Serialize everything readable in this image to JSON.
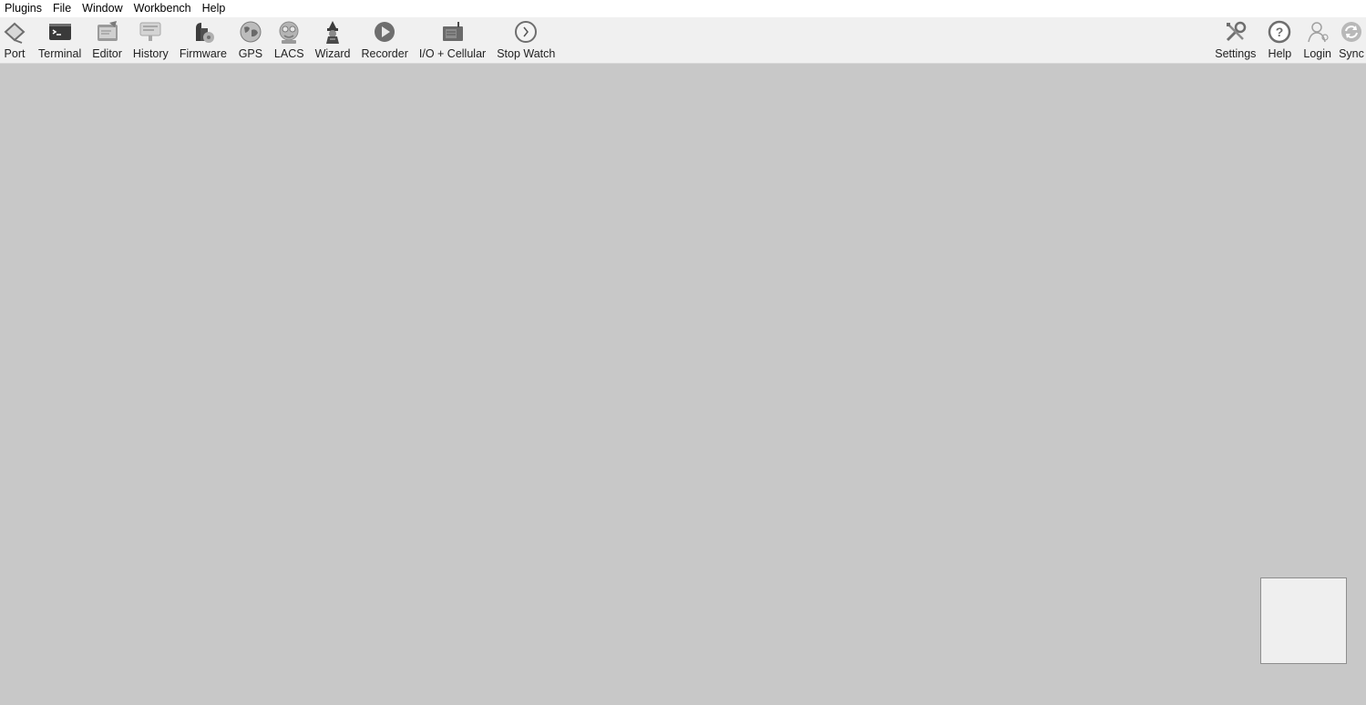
{
  "menu": {
    "items": [
      {
        "label": "Plugins"
      },
      {
        "label": "File"
      },
      {
        "label": "Window"
      },
      {
        "label": "Workbench"
      },
      {
        "label": "Help"
      }
    ]
  },
  "toolbar": {
    "left": [
      {
        "label": "Port",
        "icon": "port-icon"
      },
      {
        "label": "Terminal",
        "icon": "terminal-icon"
      },
      {
        "label": "Editor",
        "icon": "editor-icon"
      },
      {
        "label": "History",
        "icon": "history-icon"
      },
      {
        "label": "Firmware",
        "icon": "firmware-icon"
      },
      {
        "label": "GPS",
        "icon": "globe-icon"
      },
      {
        "label": "LACS",
        "icon": "lacs-icon"
      },
      {
        "label": "Wizard",
        "icon": "wizard-icon"
      },
      {
        "label": "Recorder",
        "icon": "play-icon"
      },
      {
        "label": "I/O + Cellular",
        "icon": "io-cellular-icon"
      },
      {
        "label": "Stop Watch",
        "icon": "stopwatch-icon"
      }
    ],
    "right": [
      {
        "label": "Settings",
        "icon": "settings-icon"
      },
      {
        "label": "Help",
        "icon": "help-icon"
      },
      {
        "label": "Login",
        "icon": "user-icon"
      },
      {
        "label": "Sync",
        "icon": "sync-icon"
      }
    ]
  },
  "colors": {
    "workspace_bg": "#c8c8c8",
    "toolbar_bg": "#f0f0f0",
    "menubar_bg": "#ffffff",
    "icon_gray": "#6e6e6e",
    "icon_light": "#a8a8a8"
  }
}
